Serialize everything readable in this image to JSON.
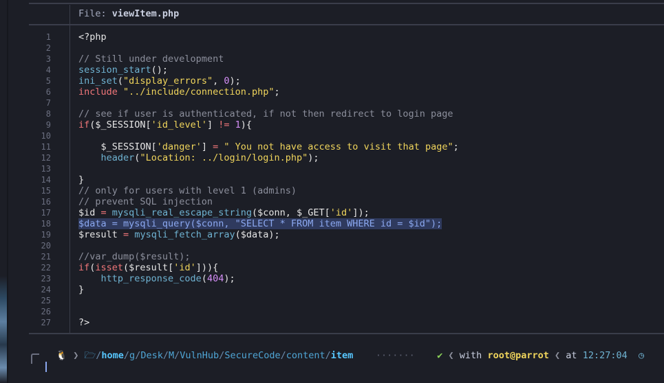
{
  "viewer": {
    "file_prefix": "File: ",
    "file_name": "viewItem.php"
  },
  "lines": [
    {
      "n": "1",
      "tokens": [
        {
          "t": "<?php",
          "c": "var"
        }
      ]
    },
    {
      "n": "2",
      "tokens": []
    },
    {
      "n": "3",
      "tokens": [
        {
          "t": "// Still under development",
          "c": "cm"
        }
      ]
    },
    {
      "n": "4",
      "tokens": [
        {
          "t": "session_start",
          "c": "fn"
        },
        {
          "t": "();",
          "c": "var"
        }
      ]
    },
    {
      "n": "5",
      "tokens": [
        {
          "t": "ini_set",
          "c": "fn"
        },
        {
          "t": "(",
          "c": "var"
        },
        {
          "t": "\"display_errors\"",
          "c": "str"
        },
        {
          "t": ", ",
          "c": "var"
        },
        {
          "t": "0",
          "c": "num"
        },
        {
          "t": ");",
          "c": "var"
        }
      ]
    },
    {
      "n": "6",
      "tokens": [
        {
          "t": "include",
          "c": "kw"
        },
        {
          "t": " ",
          "c": "var"
        },
        {
          "t": "\"../include/connection.php\"",
          "c": "str"
        },
        {
          "t": ";",
          "c": "var"
        }
      ]
    },
    {
      "n": "7",
      "tokens": []
    },
    {
      "n": "8",
      "tokens": [
        {
          "t": "// see if user is authenticated, if not then redirect to login page",
          "c": "cm"
        }
      ]
    },
    {
      "n": "9",
      "tokens": [
        {
          "t": "if",
          "c": "kw"
        },
        {
          "t": "($_SESSION[",
          "c": "var"
        },
        {
          "t": "'id_level'",
          "c": "str"
        },
        {
          "t": "] ",
          "c": "var"
        },
        {
          "t": "!=",
          "c": "op"
        },
        {
          "t": " ",
          "c": "var"
        },
        {
          "t": "1",
          "c": "num"
        },
        {
          "t": "){",
          "c": "var"
        }
      ]
    },
    {
      "n": "10",
      "tokens": []
    },
    {
      "n": "11",
      "tokens": [
        {
          "t": "    $_SESSION[",
          "c": "var"
        },
        {
          "t": "'danger'",
          "c": "str"
        },
        {
          "t": "] ",
          "c": "var"
        },
        {
          "t": "=",
          "c": "op"
        },
        {
          "t": " ",
          "c": "var"
        },
        {
          "t": "\" You not have access to visit that page\"",
          "c": "str"
        },
        {
          "t": ";",
          "c": "var"
        }
      ]
    },
    {
      "n": "12",
      "tokens": [
        {
          "t": "    ",
          "c": "var"
        },
        {
          "t": "header",
          "c": "fn"
        },
        {
          "t": "(",
          "c": "var"
        },
        {
          "t": "\"Location: ../login/login.php\"",
          "c": "str"
        },
        {
          "t": ");",
          "c": "var"
        }
      ]
    },
    {
      "n": "13",
      "tokens": []
    },
    {
      "n": "14",
      "tokens": [
        {
          "t": "}",
          "c": "var"
        }
      ]
    },
    {
      "n": "15",
      "tokens": [
        {
          "t": "// only for users with level 1 (admins)",
          "c": "cm"
        }
      ]
    },
    {
      "n": "16",
      "tokens": [
        {
          "t": "// prevent SQL injection",
          "c": "cm"
        }
      ]
    },
    {
      "n": "17",
      "tokens": [
        {
          "t": "$id ",
          "c": "var"
        },
        {
          "t": "=",
          "c": "op"
        },
        {
          "t": " ",
          "c": "var"
        },
        {
          "t": "mysqli_real_escape_string",
          "c": "fn"
        },
        {
          "t": "($conn, $_GET[",
          "c": "var"
        },
        {
          "t": "'id'",
          "c": "str"
        },
        {
          "t": "]);",
          "c": "var"
        }
      ]
    },
    {
      "n": "18",
      "highlight": true,
      "tokens": [
        {
          "t": "$data = mysqli_query($conn, \"SELECT * FROM item WHERE id = $id\");",
          "c": "hl"
        }
      ]
    },
    {
      "n": "19",
      "tokens": [
        {
          "t": "$result ",
          "c": "var"
        },
        {
          "t": "=",
          "c": "op"
        },
        {
          "t": " ",
          "c": "var"
        },
        {
          "t": "mysqli_fetch_array",
          "c": "fn"
        },
        {
          "t": "($data);",
          "c": "var"
        }
      ]
    },
    {
      "n": "20",
      "tokens": []
    },
    {
      "n": "21",
      "tokens": [
        {
          "t": "//var_dump($result);",
          "c": "cm"
        }
      ]
    },
    {
      "n": "22",
      "tokens": [
        {
          "t": "if",
          "c": "kw"
        },
        {
          "t": "(",
          "c": "var"
        },
        {
          "t": "isset",
          "c": "kw"
        },
        {
          "t": "($result[",
          "c": "var"
        },
        {
          "t": "'id'",
          "c": "str"
        },
        {
          "t": "])){",
          "c": "var"
        }
      ]
    },
    {
      "n": "23",
      "tokens": [
        {
          "t": "    ",
          "c": "var"
        },
        {
          "t": "http_response_code",
          "c": "fn"
        },
        {
          "t": "(",
          "c": "var"
        },
        {
          "t": "404",
          "c": "num"
        },
        {
          "t": ");",
          "c": "var"
        }
      ]
    },
    {
      "n": "24",
      "tokens": [
        {
          "t": "}",
          "c": "var"
        }
      ]
    },
    {
      "n": "25",
      "tokens": []
    },
    {
      "n": "26",
      "tokens": []
    },
    {
      "n": "27",
      "tokens": [
        {
          "t": "?>",
          "c": "var"
        }
      ]
    }
  ],
  "prompt": {
    "os_icon": "🐧",
    "sep": "❯",
    "folder_icon": "🗁",
    "path": [
      {
        "t": "/",
        "c": "p-dim"
      },
      {
        "t": "home",
        "c": "p-bold"
      },
      {
        "t": "/",
        "c": "p-dim"
      },
      {
        "t": "g",
        "c": "p-dir"
      },
      {
        "t": "/",
        "c": "p-dim"
      },
      {
        "t": "Desk",
        "c": "p-dir"
      },
      {
        "t": "/",
        "c": "p-dim"
      },
      {
        "t": "M",
        "c": "p-dir"
      },
      {
        "t": "/",
        "c": "p-dim"
      },
      {
        "t": "VulnHub",
        "c": "p-dir"
      },
      {
        "t": "/",
        "c": "p-dim"
      },
      {
        "t": "SecureCode",
        "c": "p-dir"
      },
      {
        "t": "/",
        "c": "p-dim"
      },
      {
        "t": "content",
        "c": "p-dir"
      },
      {
        "t": "/",
        "c": "p-dim"
      },
      {
        "t": "item",
        "c": "p-bold"
      }
    ],
    "dots": "·······",
    "status_ok": "✔",
    "rsep": "❮",
    "with_label": "with",
    "user_host": "root@parrot",
    "at_label": "at",
    "time": "12:27:04",
    "clock_icon": "◷"
  },
  "colors": {
    "background": "#1c1e26",
    "comment": "#8c8f9c",
    "keyword": "#f2777a",
    "function": "#6fb3d2",
    "string": "#f0d55c",
    "number": "#d58ff7",
    "highlight": "#2f3a5e"
  }
}
